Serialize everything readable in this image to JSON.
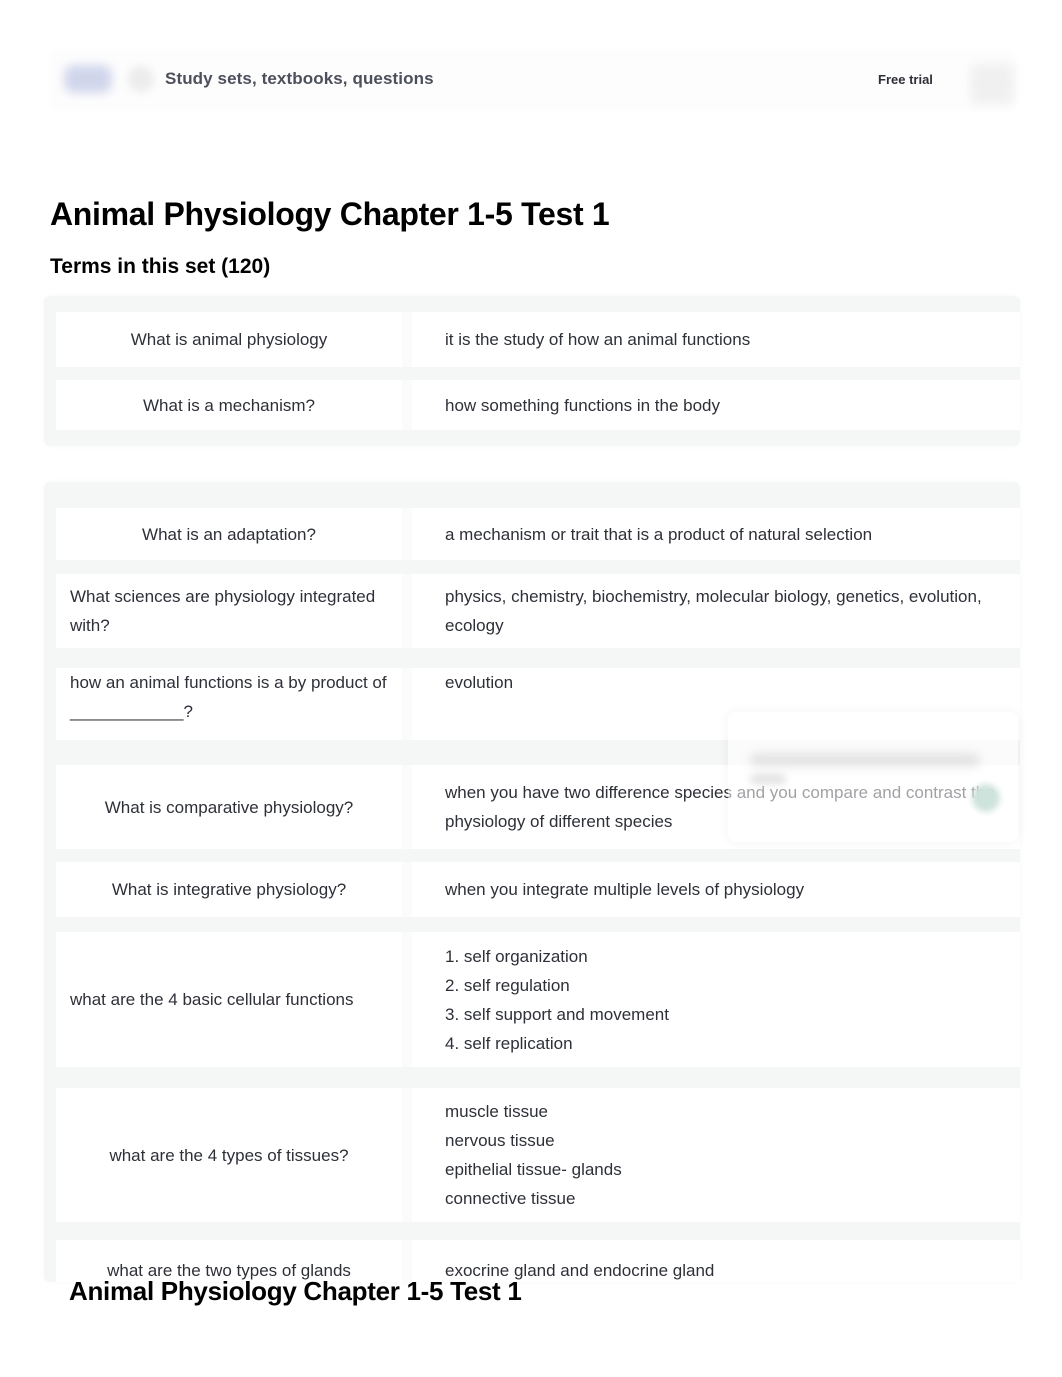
{
  "header": {
    "search_placeholder": "Study sets, textbooks, questions",
    "free_trial_label": "Free trial"
  },
  "page": {
    "title": "Animal Physiology Chapter 1-5 Test 1",
    "terms_heading": "Terms in this set (120)",
    "footer_title": "Animal Physiology Chapter 1-5 Test 1"
  },
  "terms": [
    {
      "term": "What is animal physiology",
      "definition": [
        "it is the study of how an animal functions"
      ]
    },
    {
      "term": "What is a mechanism?",
      "definition": [
        "how something functions in the body"
      ]
    },
    {
      "term": "What is an adaptation?",
      "definition": [
        "a mechanism or trait that is a product of natural selection"
      ]
    },
    {
      "term": "What sciences are physiology integrated with?",
      "definition": [
        "physics, chemistry, biochemistry, molecular biology, genetics, evolution, ecology"
      ]
    },
    {
      "term": "how an animal functions is a by product of ____________?",
      "definition": [
        "evolution"
      ]
    },
    {
      "term": "What is comparative physiology?",
      "definition": [
        "when you have two difference species and you compare and contrast the physiology of different species"
      ]
    },
    {
      "term": "What is integrative physiology?",
      "definition": [
        "when you integrate multiple levels of physiology"
      ]
    },
    {
      "term": "what are the 4 basic cellular functions",
      "definition": [
        "1. self organization",
        "2. self regulation",
        "3. self support and movement",
        "4. self replication"
      ]
    },
    {
      "term": "what are the 4 types of tissues?",
      "definition": [
        "muscle tissue",
        "nervous tissue",
        "epithelial tissue- glands",
        "connective tissue"
      ]
    },
    {
      "term": "what are the two types of glands",
      "definition": [
        "exocrine gland and endocrine gland"
      ]
    }
  ]
}
